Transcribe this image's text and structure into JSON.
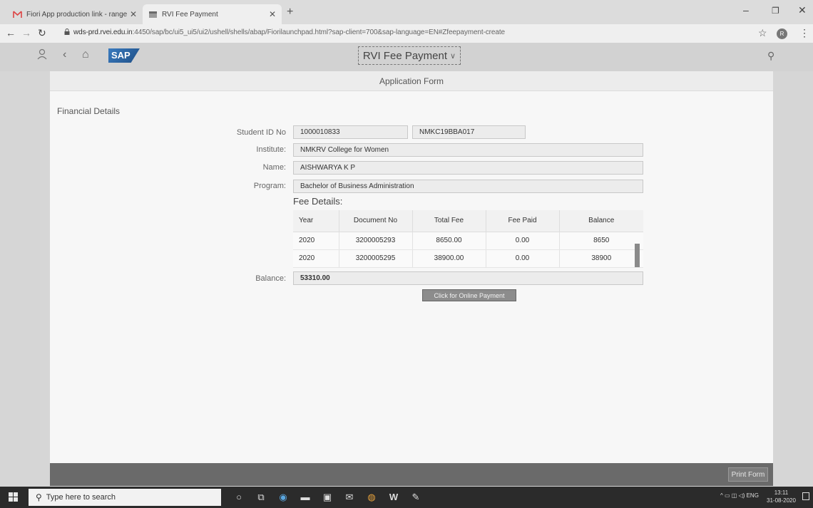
{
  "browser": {
    "tabs": [
      {
        "label": "Fiori App production link - range",
        "favicon": "gmail-icon"
      },
      {
        "label": "RVI Fee Payment",
        "favicon": "page-icon"
      }
    ],
    "url_host": "wds-prd.rvei.edu.in",
    "url_path": ":4450/sap/bc/ui5_ui5/ui2/ushell/shells/abap/Fiorilaunchpad.html?sap-client=700&sap-language=EN#Zfeepayment-create",
    "profile_initial": "R"
  },
  "shell": {
    "logo_text": "SAP",
    "app_title": "RVI Fee Payment"
  },
  "page": {
    "header": "Application Form",
    "section_title": "Financial Details",
    "fields": {
      "student_id_label": "Student ID No",
      "student_id": "1000010833",
      "student_code": "NMKC19BBA017",
      "institute_label": "Institute:",
      "institute": "NMKRV College for Women",
      "name_label": "Name:",
      "name": "AISHWARYA K P",
      "program_label": "Program:",
      "program": "Bachelor of Business Administration",
      "balance_label": "Balance:",
      "balance": "53310.00"
    },
    "fee_details_title": "Fee Details:",
    "table": {
      "columns": [
        "Year",
        "Document No",
        "Total Fee",
        "Fee Paid",
        "Balance"
      ],
      "rows": [
        [
          "2020",
          "3200005293",
          "8650.00",
          "0.00",
          "8650"
        ],
        [
          "2020",
          "3200005295",
          "38900.00",
          "0.00",
          "38900"
        ]
      ]
    },
    "pay_button": "Click for Online Payment",
    "print_button": "Print Form"
  },
  "taskbar": {
    "search_placeholder": "Type here to search",
    "lang": "ENG",
    "time": "13:11",
    "date": "31-08-2020"
  },
  "colors": {
    "page_bg": "#f7f7f7",
    "footer_bar": "#6a6a6a",
    "button_gray": "#8c8c8c",
    "sap_blue": "#2a64a4"
  }
}
